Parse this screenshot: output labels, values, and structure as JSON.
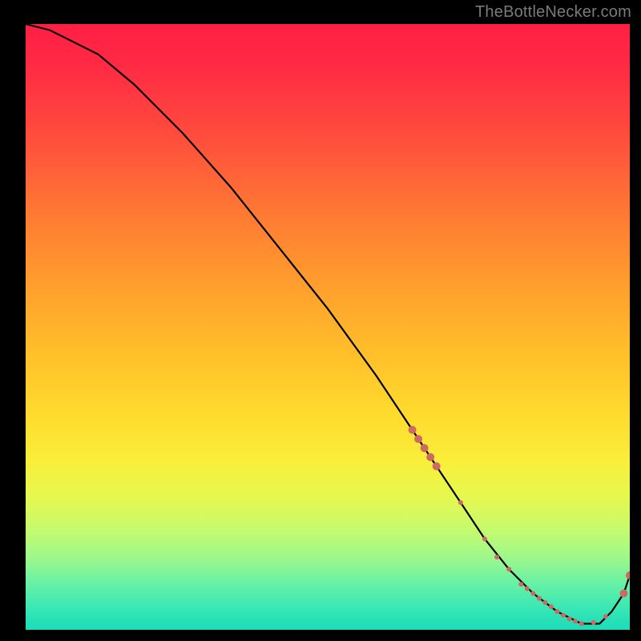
{
  "attribution": "TheBottleNecker.com",
  "chart_data": {
    "type": "line",
    "title": "",
    "xlabel": "",
    "ylabel": "",
    "xlim": [
      0,
      100
    ],
    "ylim": [
      0,
      100
    ],
    "background_gradient": {
      "orientation": "vertical",
      "stops": [
        {
          "pct": 0,
          "color": "#ff1f44"
        },
        {
          "pct": 50,
          "color": "#ffbe2a"
        },
        {
          "pct": 80,
          "color": "#e6f84e"
        },
        {
          "pct": 100,
          "color": "#1bdcba"
        }
      ]
    },
    "series": [
      {
        "name": "bottleneck-curve",
        "color": "#000000",
        "x": [
          0,
          4,
          8,
          12,
          18,
          26,
          34,
          42,
          50,
          58,
          64,
          68,
          72,
          76,
          80,
          84,
          88,
          92,
          95,
          97,
          99,
          100
        ],
        "y": [
          100,
          99,
          97,
          95,
          90,
          82,
          73,
          63,
          53,
          42,
          33,
          27,
          21,
          15,
          10,
          6,
          3,
          1,
          1,
          3,
          6,
          9
        ]
      }
    ],
    "markers": {
      "name": "highlighted-points",
      "color": "#cc6a63",
      "radius_main": 5,
      "radius_small": 3,
      "x": [
        64,
        65,
        66,
        67,
        68,
        72,
        76,
        78,
        80,
        82,
        83,
        84,
        85,
        86,
        87,
        88,
        89,
        90,
        91,
        92,
        94,
        96,
        99,
        100
      ],
      "y": [
        33,
        31.5,
        30,
        28.5,
        27,
        21,
        15,
        12,
        10,
        7.5,
        6.8,
        6,
        5.2,
        4.5,
        3.8,
        3,
        2.4,
        1.8,
        1.4,
        1,
        1.2,
        2.2,
        6,
        9
      ]
    }
  }
}
